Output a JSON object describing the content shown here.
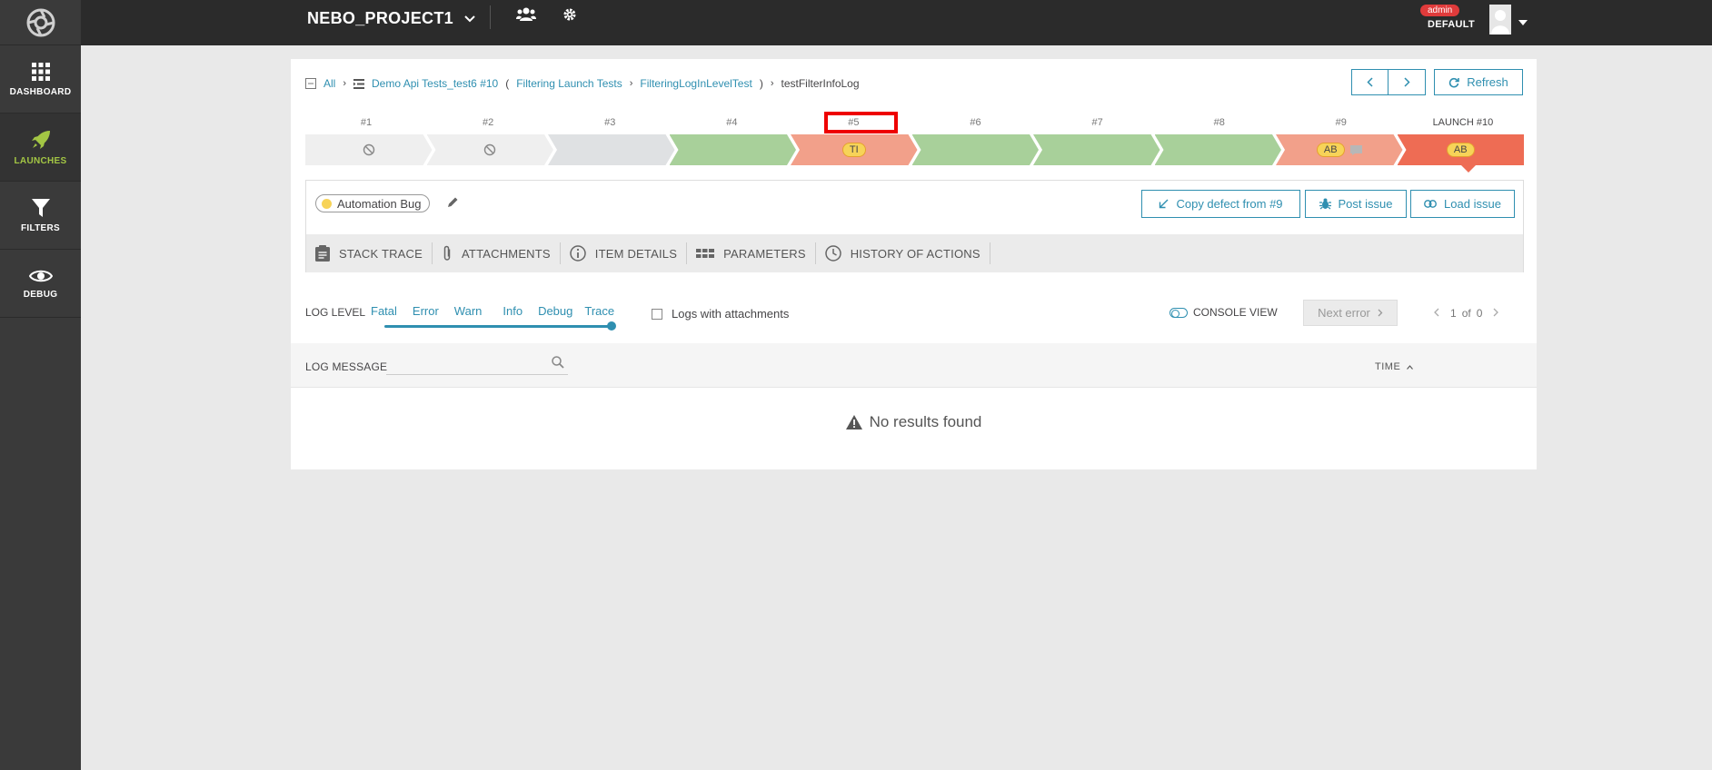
{
  "sidebar": {
    "items": [
      {
        "label": "DASHBOARD",
        "icon": "grid-icon"
      },
      {
        "label": "LAUNCHES",
        "icon": "rocket-icon",
        "active": true
      },
      {
        "label": "FILTERS",
        "icon": "filter-icon"
      },
      {
        "label": "DEBUG",
        "icon": "eye-icon"
      }
    ]
  },
  "topbar": {
    "project": "NEBO_PROJECT1",
    "admin_badge": "admin",
    "role": "DEFAULT"
  },
  "breadcrumb": {
    "all": "All",
    "launch": "Demo Api Tests_test6 #10",
    "open_paren": "(",
    "suite": "Filtering Launch Tests",
    "test": "FilteringLogInLevelTest",
    "close_paren": ")",
    "current": "testFilterInfoLog"
  },
  "actions": {
    "refresh": "Refresh",
    "copy_defect": "Copy defect from #9",
    "post_issue": "Post issue",
    "load_issue": "Load issue"
  },
  "history": {
    "labels": [
      "#1",
      "#2",
      "#3",
      "#4",
      "#5",
      "#6",
      "#7",
      "#8",
      "#9",
      "LAUNCH #10"
    ],
    "segments": [
      {
        "status": "skipped",
        "badge": ""
      },
      {
        "status": "skipped",
        "badge": ""
      },
      {
        "status": "no-item",
        "badge": ""
      },
      {
        "status": "passed",
        "badge": ""
      },
      {
        "status": "failed",
        "badge": "TI"
      },
      {
        "status": "passed",
        "badge": ""
      },
      {
        "status": "passed",
        "badge": ""
      },
      {
        "status": "passed",
        "badge": ""
      },
      {
        "status": "failed",
        "badge": "AB"
      },
      {
        "status": "failed-current",
        "badge": "AB"
      }
    ],
    "colors": {
      "skipped": "#efefef",
      "no-item": "#dfe1e3",
      "passed": "#a8d09a",
      "failed": "#f2a08a",
      "failed-current": "#ee6c54"
    }
  },
  "defect": {
    "type": "Automation Bug",
    "color": "#f7d358"
  },
  "tabs": [
    "STACK TRACE",
    "ATTACHMENTS",
    "ITEM DETAILS",
    "PARAMETERS",
    "HISTORY OF ACTIONS"
  ],
  "log_filter": {
    "label": "LOG LEVEL",
    "levels": [
      "Fatal",
      "Error",
      "Warn",
      "Info",
      "Debug",
      "Trace"
    ],
    "attachments_label": "Logs with attachments",
    "console_view": "CONSOLE VIEW",
    "next_error": "Next error",
    "page_current": "1",
    "page_of": "of",
    "page_total": "0"
  },
  "log_table": {
    "message_header": "LOG MESSAGE",
    "time_header": "TIME",
    "empty": "No results found"
  }
}
